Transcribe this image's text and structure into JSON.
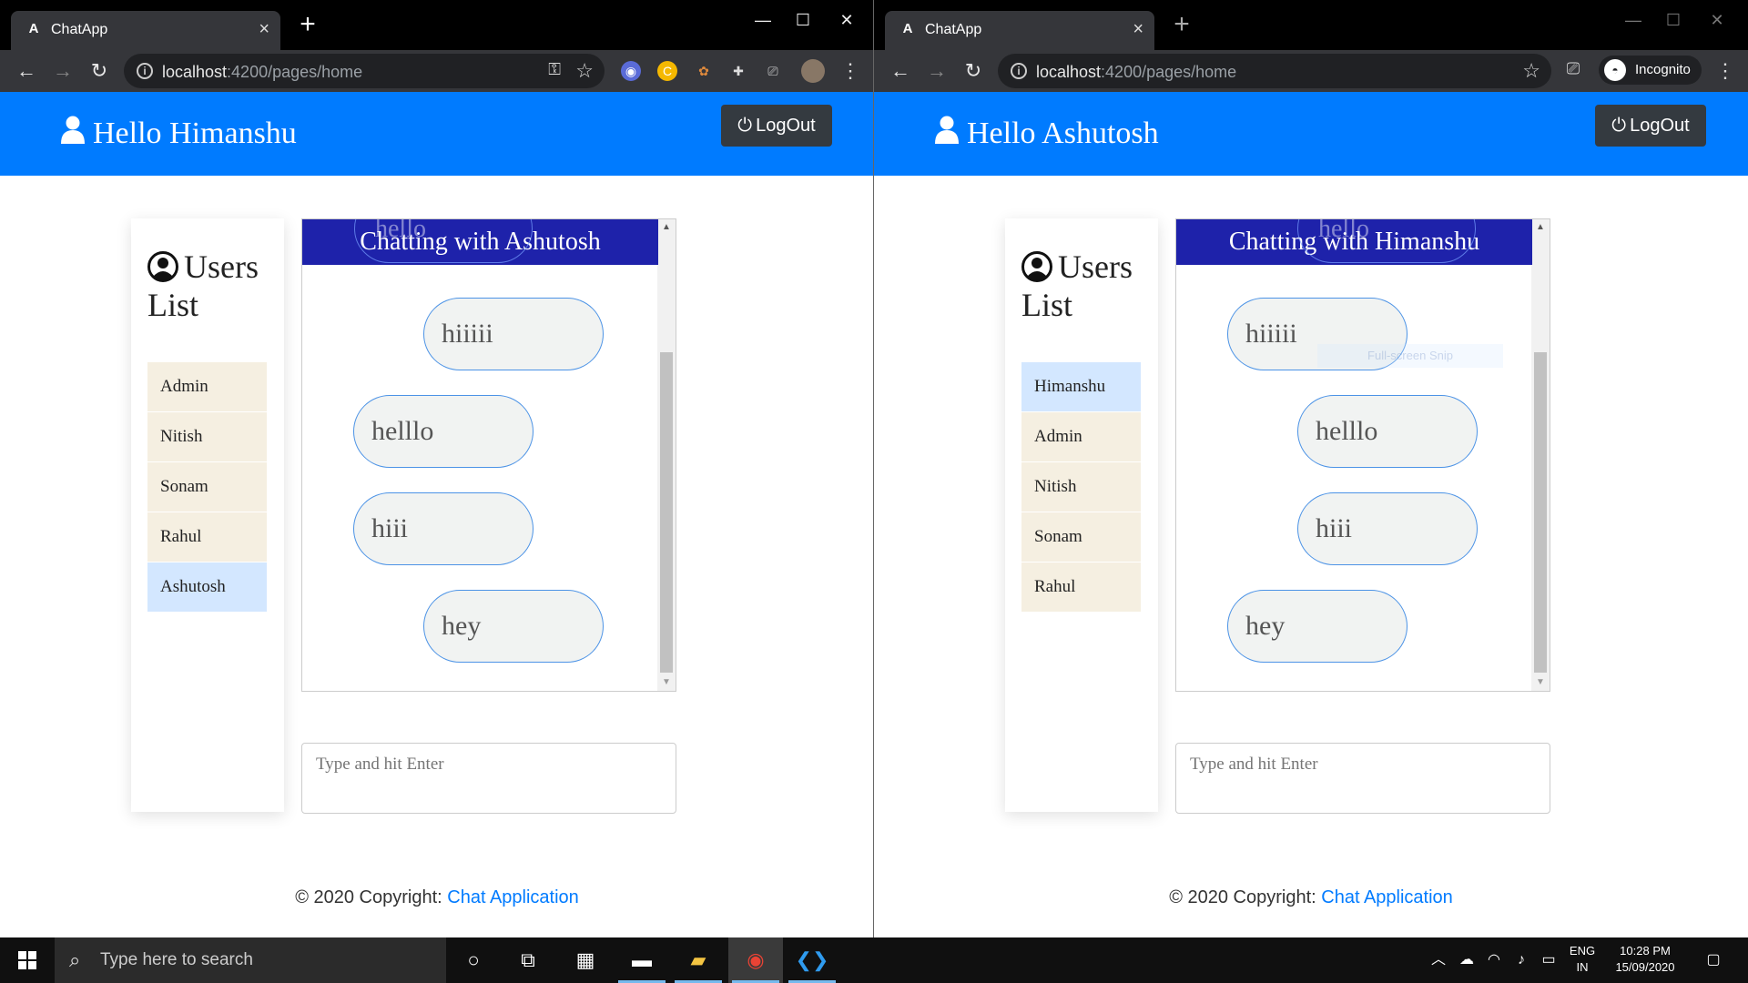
{
  "windows": [
    {
      "tab_title": "ChatApp",
      "url_host": "localhost",
      "url_path": ":4200/pages/home",
      "greeting": "Hello Himanshu",
      "logout_label": "LogOut",
      "users_title": "Users List",
      "users": [
        "Admin",
        "Nitish",
        "Sonam",
        "Rahul",
        "Ashutosh"
      ],
      "active_user": "Ashutosh",
      "chat_title": "Chatting with Ashutosh",
      "ghost_text": "hello",
      "messages": [
        "hiiiii",
        "helllo",
        "hiii",
        "hey"
      ],
      "input_placeholder": "Type and hit Enter",
      "footer_text": "© 2020 Copyright: ",
      "footer_link": "Chat Application"
    },
    {
      "tab_title": "ChatApp",
      "url_host": "localhost",
      "url_path": ":4200/pages/home",
      "profile_label": "Incognito",
      "greeting": "Hello Ashutosh",
      "logout_label": "LogOut",
      "users_title": "Users List",
      "users": [
        "Himanshu",
        "Admin",
        "Nitish",
        "Sonam",
        "Rahul"
      ],
      "active_user": "Himanshu",
      "chat_title": "Chatting with Himanshu",
      "ghost_text": "hello",
      "messages": [
        "hiiiii",
        "helllo",
        "hiii",
        "hey"
      ],
      "input_placeholder": "Type and hit Enter",
      "footer_text": "© 2020 Copyright: ",
      "footer_link": "Chat Application",
      "snip_hint": "Full-screen Snip"
    }
  ],
  "taskbar": {
    "search_placeholder": "Type here to search",
    "lang_line1": "ENG",
    "lang_line2": "IN",
    "time": "10:28 PM",
    "date": "15/09/2020"
  },
  "colors": {
    "header_blue": "#007bff",
    "chat_header": "#1e22aa",
    "user_item": "#f5efe1",
    "user_active": "#d3e7ff",
    "logout": "#343a40"
  }
}
